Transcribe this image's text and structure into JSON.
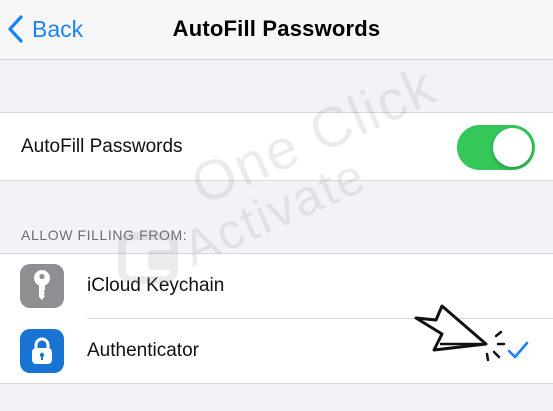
{
  "nav": {
    "back_label": "Back",
    "title": "AutoFill Passwords"
  },
  "autofill_toggle": {
    "label": "AutoFill Passwords",
    "enabled": true,
    "on_color": "#34c759"
  },
  "allow_filling": {
    "header": "ALLOW FILLING FROM:",
    "items": [
      {
        "label": "iCloud Keychain",
        "icon": "key-icon",
        "icon_color": "#8e8e93",
        "selected": false
      },
      {
        "label": "Authenticator",
        "icon": "lock-icon",
        "icon_color": "#1874d2",
        "selected": true
      }
    ]
  },
  "watermark": {
    "line1": "One Click",
    "line2": "Activate"
  },
  "colors": {
    "accent": "#1a82fb",
    "background": "#f2f2f7"
  }
}
